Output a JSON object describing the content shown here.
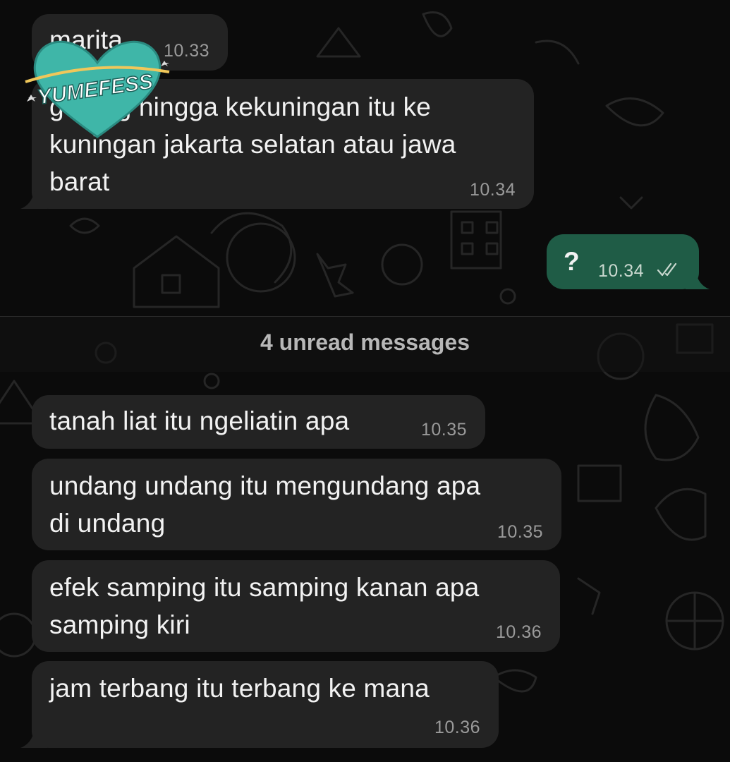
{
  "unread_divider": "4 unread messages",
  "watermark": "YUMEFESS",
  "messages": [
    {
      "direction": "in",
      "text": "marita",
      "time": "10.33"
    },
    {
      "direction": "in",
      "lines": [
        "goreng hingga kekuningan itu ke",
        "kuningan jakarta selatan atau jawa",
        "barat"
      ],
      "time": "10.34"
    },
    {
      "direction": "out",
      "text": "?",
      "time": "10.34",
      "status": "read-double-check-icon"
    },
    {
      "direction": "in",
      "text": "tanah liat itu ngeliatin apa",
      "time": "10.35"
    },
    {
      "direction": "in",
      "lines": [
        "undang undang itu mengundang apa",
        "di undang"
      ],
      "time": "10.35"
    },
    {
      "direction": "in",
      "lines": [
        "efek samping itu samping kanan apa",
        "samping kiri"
      ],
      "time": "10.36"
    },
    {
      "direction": "in",
      "text": "jam terbang itu terbang ke mana",
      "time": "10.36"
    }
  ],
  "colors": {
    "background": "#0b0b0b",
    "incoming_bubble": "#232323",
    "outgoing_bubble": "#1f5c46",
    "watermark_accent": "#3fb6a8"
  }
}
